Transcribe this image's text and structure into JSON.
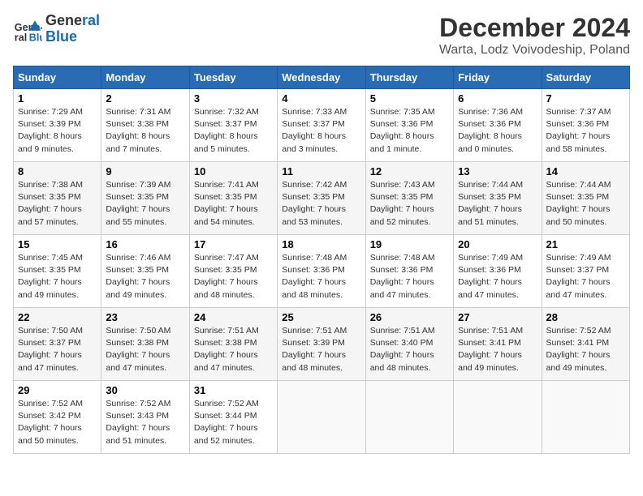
{
  "logo": {
    "line1": "General",
    "line2": "Blue"
  },
  "title": "December 2024",
  "subtitle": "Warta, Lodz Voivodeship, Poland",
  "days_of_week": [
    "Sunday",
    "Monday",
    "Tuesday",
    "Wednesday",
    "Thursday",
    "Friday",
    "Saturday"
  ],
  "weeks": [
    [
      {
        "day": 1,
        "sunrise": "7:29 AM",
        "sunset": "3:39 PM",
        "daylight": "8 hours and 9 minutes."
      },
      {
        "day": 2,
        "sunrise": "7:31 AM",
        "sunset": "3:38 PM",
        "daylight": "8 hours and 7 minutes."
      },
      {
        "day": 3,
        "sunrise": "7:32 AM",
        "sunset": "3:37 PM",
        "daylight": "8 hours and 5 minutes."
      },
      {
        "day": 4,
        "sunrise": "7:33 AM",
        "sunset": "3:37 PM",
        "daylight": "8 hours and 3 minutes."
      },
      {
        "day": 5,
        "sunrise": "7:35 AM",
        "sunset": "3:36 PM",
        "daylight": "8 hours and 1 minute."
      },
      {
        "day": 6,
        "sunrise": "7:36 AM",
        "sunset": "3:36 PM",
        "daylight": "8 hours and 0 minutes."
      },
      {
        "day": 7,
        "sunrise": "7:37 AM",
        "sunset": "3:36 PM",
        "daylight": "7 hours and 58 minutes."
      }
    ],
    [
      {
        "day": 8,
        "sunrise": "7:38 AM",
        "sunset": "3:35 PM",
        "daylight": "7 hours and 57 minutes."
      },
      {
        "day": 9,
        "sunrise": "7:39 AM",
        "sunset": "3:35 PM",
        "daylight": "7 hours and 55 minutes."
      },
      {
        "day": 10,
        "sunrise": "7:41 AM",
        "sunset": "3:35 PM",
        "daylight": "7 hours and 54 minutes."
      },
      {
        "day": 11,
        "sunrise": "7:42 AM",
        "sunset": "3:35 PM",
        "daylight": "7 hours and 53 minutes."
      },
      {
        "day": 12,
        "sunrise": "7:43 AM",
        "sunset": "3:35 PM",
        "daylight": "7 hours and 52 minutes."
      },
      {
        "day": 13,
        "sunrise": "7:44 AM",
        "sunset": "3:35 PM",
        "daylight": "7 hours and 51 minutes."
      },
      {
        "day": 14,
        "sunrise": "7:44 AM",
        "sunset": "3:35 PM",
        "daylight": "7 hours and 50 minutes."
      }
    ],
    [
      {
        "day": 15,
        "sunrise": "7:45 AM",
        "sunset": "3:35 PM",
        "daylight": "7 hours and 49 minutes."
      },
      {
        "day": 16,
        "sunrise": "7:46 AM",
        "sunset": "3:35 PM",
        "daylight": "7 hours and 49 minutes."
      },
      {
        "day": 17,
        "sunrise": "7:47 AM",
        "sunset": "3:35 PM",
        "daylight": "7 hours and 48 minutes."
      },
      {
        "day": 18,
        "sunrise": "7:48 AM",
        "sunset": "3:36 PM",
        "daylight": "7 hours and 48 minutes."
      },
      {
        "day": 19,
        "sunrise": "7:48 AM",
        "sunset": "3:36 PM",
        "daylight": "7 hours and 47 minutes."
      },
      {
        "day": 20,
        "sunrise": "7:49 AM",
        "sunset": "3:36 PM",
        "daylight": "7 hours and 47 minutes."
      },
      {
        "day": 21,
        "sunrise": "7:49 AM",
        "sunset": "3:37 PM",
        "daylight": "7 hours and 47 minutes."
      }
    ],
    [
      {
        "day": 22,
        "sunrise": "7:50 AM",
        "sunset": "3:37 PM",
        "daylight": "7 hours and 47 minutes."
      },
      {
        "day": 23,
        "sunrise": "7:50 AM",
        "sunset": "3:38 PM",
        "daylight": "7 hours and 47 minutes."
      },
      {
        "day": 24,
        "sunrise": "7:51 AM",
        "sunset": "3:38 PM",
        "daylight": "7 hours and 47 minutes."
      },
      {
        "day": 25,
        "sunrise": "7:51 AM",
        "sunset": "3:39 PM",
        "daylight": "7 hours and 48 minutes."
      },
      {
        "day": 26,
        "sunrise": "7:51 AM",
        "sunset": "3:40 PM",
        "daylight": "7 hours and 48 minutes."
      },
      {
        "day": 27,
        "sunrise": "7:51 AM",
        "sunset": "3:41 PM",
        "daylight": "7 hours and 49 minutes."
      },
      {
        "day": 28,
        "sunrise": "7:52 AM",
        "sunset": "3:41 PM",
        "daylight": "7 hours and 49 minutes."
      }
    ],
    [
      {
        "day": 29,
        "sunrise": "7:52 AM",
        "sunset": "3:42 PM",
        "daylight": "7 hours and 50 minutes."
      },
      {
        "day": 30,
        "sunrise": "7:52 AM",
        "sunset": "3:43 PM",
        "daylight": "7 hours and 51 minutes."
      },
      {
        "day": 31,
        "sunrise": "7:52 AM",
        "sunset": "3:44 PM",
        "daylight": "7 hours and 52 minutes."
      },
      null,
      null,
      null,
      null
    ]
  ]
}
